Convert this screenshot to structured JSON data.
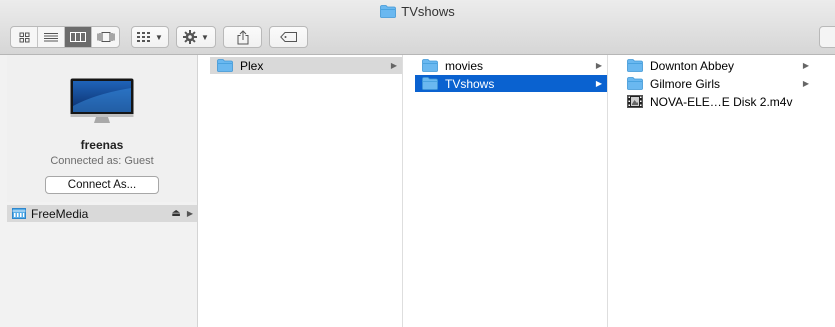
{
  "window": {
    "title": "TVshows"
  },
  "toolbar": {
    "view_modes": [
      "icon-view-icon",
      "list-view-icon",
      "column-view-icon",
      "cover-flow-icon"
    ],
    "active_view": 2
  },
  "sidebar": {
    "server": {
      "name": "freenas",
      "status": "Connected as: Guest",
      "connect_label": "Connect As..."
    },
    "share": {
      "label": "FreeMedia"
    }
  },
  "columns": [
    {
      "items": [
        {
          "name": "Plex",
          "kind": "folder",
          "selected": "gray"
        }
      ]
    },
    {
      "items": [
        {
          "name": "movies",
          "kind": "folder",
          "selected": ""
        },
        {
          "name": "TVshows",
          "kind": "folder",
          "selected": "blue"
        }
      ]
    },
    {
      "items": [
        {
          "name": "Downton Abbey",
          "kind": "folder",
          "selected": ""
        },
        {
          "name": "Gilmore Girls",
          "kind": "folder",
          "selected": ""
        },
        {
          "name": "NOVA-ELE…E Disk 2.m4v",
          "kind": "video",
          "selected": ""
        }
      ]
    }
  ],
  "colors": {
    "selection_blue": "#0a62d0",
    "folder_blue": "#6ab8f0"
  }
}
